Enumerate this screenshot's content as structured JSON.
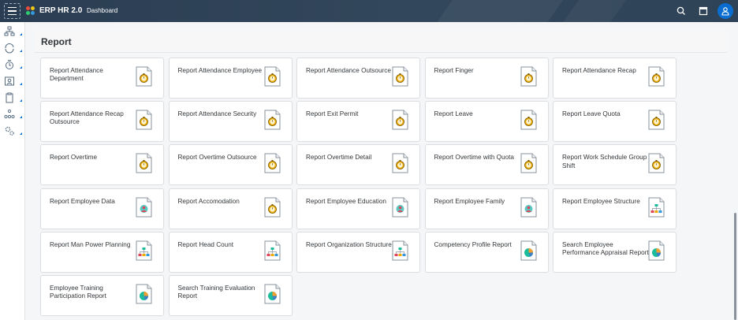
{
  "header": {
    "app_title": "ERP HR 2.0",
    "breadcrumb": "Dashboard",
    "icons": [
      "menu-icon",
      "search-icon",
      "window-icon",
      "user-icon"
    ]
  },
  "rail": {
    "items": [
      "org-icon",
      "refresh-icon",
      "timer-icon",
      "people-icon",
      "clipboard-icon",
      "org-chart-icon",
      "gears-icon"
    ]
  },
  "section": {
    "title": "Report"
  },
  "tiles": [
    {
      "label": "Report Attendance Department",
      "icon": "stopwatch-doc-icon"
    },
    {
      "label": "Report Attendance Employee",
      "icon": "stopwatch-doc-icon"
    },
    {
      "label": "Report Attendance Outsource",
      "icon": "stopwatch-doc-icon"
    },
    {
      "label": "Report Finger",
      "icon": "stopwatch-doc-icon"
    },
    {
      "label": "Report Attendance Recap",
      "icon": "stopwatch-doc-icon"
    },
    {
      "label": "Report Attendance Recap Outsource",
      "icon": "stopwatch-doc-icon"
    },
    {
      "label": "Report Attendance Security",
      "icon": "stopwatch-doc-icon"
    },
    {
      "label": "Report Exit Permit",
      "icon": "stopwatch-doc-icon"
    },
    {
      "label": "Report Leave",
      "icon": "stopwatch-doc-icon"
    },
    {
      "label": "Report Leave Quota",
      "icon": "stopwatch-doc-icon"
    },
    {
      "label": "Report Overtime",
      "icon": "stopwatch-doc-icon"
    },
    {
      "label": "Report Overtime Outsource",
      "icon": "stopwatch-doc-icon"
    },
    {
      "label": "Report Overtime Detail",
      "icon": "stopwatch-doc-icon"
    },
    {
      "label": "Report Overtime with Quota",
      "icon": "stopwatch-doc-icon"
    },
    {
      "label": "Report Work Schedule Group Shift",
      "icon": "stopwatch-doc-icon"
    },
    {
      "label": "Report Employee Data",
      "icon": "person-doc-icon"
    },
    {
      "label": "Report Accomodation",
      "icon": "stopwatch-doc-icon"
    },
    {
      "label": "Report Employee Education",
      "icon": "person-doc-icon"
    },
    {
      "label": "Report Employee Family",
      "icon": "person-doc-icon"
    },
    {
      "label": "Report Employee Structure",
      "icon": "org-doc-icon"
    },
    {
      "label": "Report Man Power Planning",
      "icon": "org-doc-icon"
    },
    {
      "label": "Report Head Count",
      "icon": "org-doc-icon"
    },
    {
      "label": "Report Organization Structure",
      "icon": "org-doc-icon"
    },
    {
      "label": "Competency Profile Report",
      "icon": "pie-doc-icon"
    },
    {
      "label": "Search Employee Performance Appraisal Report",
      "icon": "pie-doc-icon"
    },
    {
      "label": "Employee Training Participation Report",
      "icon": "pie-doc-icon"
    },
    {
      "label": "Search Training Evaluation Report",
      "icon": "pie-doc-icon"
    }
  ],
  "colors": {
    "header_bg": "#2f4358",
    "accent": "#0a6ed1",
    "stopwatch": "#f0ab00",
    "person": "#e0445a",
    "org": "#1abc9c",
    "pie_teal": "#1abc9c",
    "pie_orange": "#f0a030"
  }
}
